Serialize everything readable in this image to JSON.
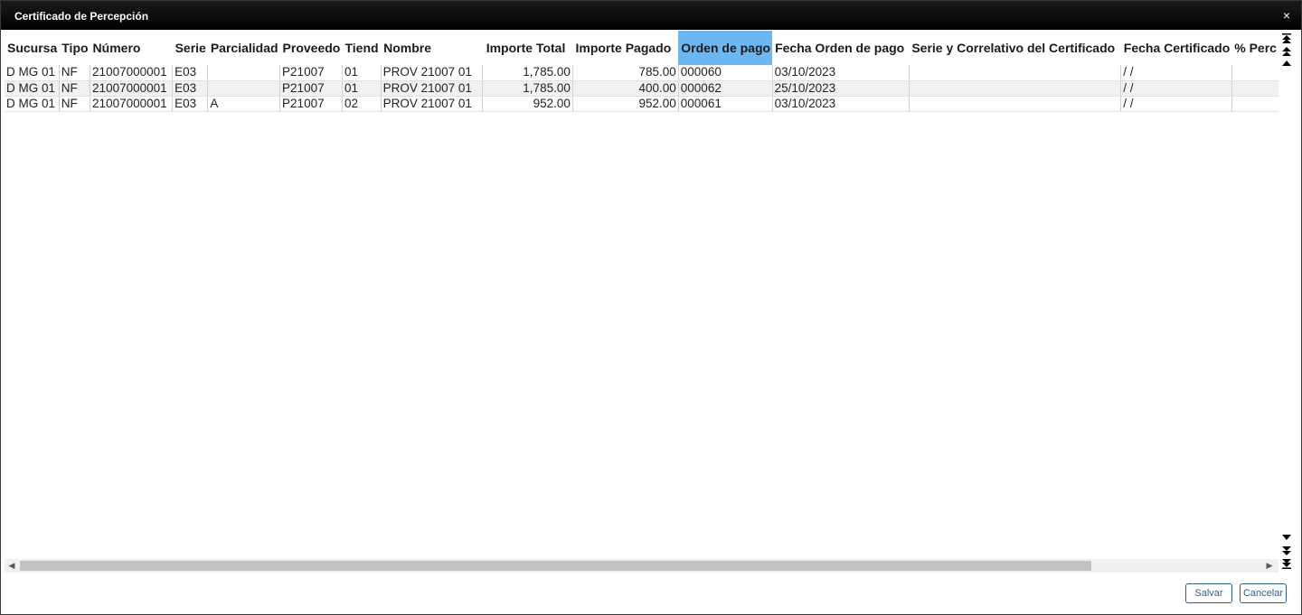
{
  "dialog": {
    "title": "Certificado de Percepción",
    "close": "×"
  },
  "table": {
    "headers": [
      "Sucursa",
      "Tipo",
      "Número",
      "Serie",
      "Parcialidad",
      "Proveedo",
      "Tiend",
      "Nombre",
      "Importe Total",
      "Importe Pagado",
      "Orden de pago",
      "Fecha Orden de pago",
      "Serie y Correlativo del Certificado",
      "Fecha Certificado",
      "% Perc"
    ],
    "selected_column": "Orden de pago",
    "rows": [
      [
        "D MG 01",
        "NF",
        "21007000001",
        "E03",
        "",
        "P21007",
        "01",
        "PROV 21007 01",
        "1,785.00",
        "785.00",
        "000060",
        "03/10/2023",
        "",
        "/ /",
        ""
      ],
      [
        "D MG 01",
        "NF",
        "21007000001",
        "E03",
        "",
        "P21007",
        "01",
        "PROV 21007 01",
        "1,785.00",
        "400.00",
        "000062",
        "25/10/2023",
        "",
        "/ /",
        ""
      ],
      [
        "D MG 01",
        "NF",
        "21007000001",
        "E03",
        "A",
        "P21007",
        "02",
        "PROV 21007 01",
        "952.00",
        "952.00",
        "000061",
        "03/10/2023",
        "",
        "/ /",
        ""
      ]
    ]
  },
  "buttons": {
    "save": "Salvar",
    "cancel": "Cancelar"
  },
  "colors": {
    "titlebar": "#000000",
    "selected_header": "#6db6ef",
    "button_border": "#2f5f87"
  }
}
